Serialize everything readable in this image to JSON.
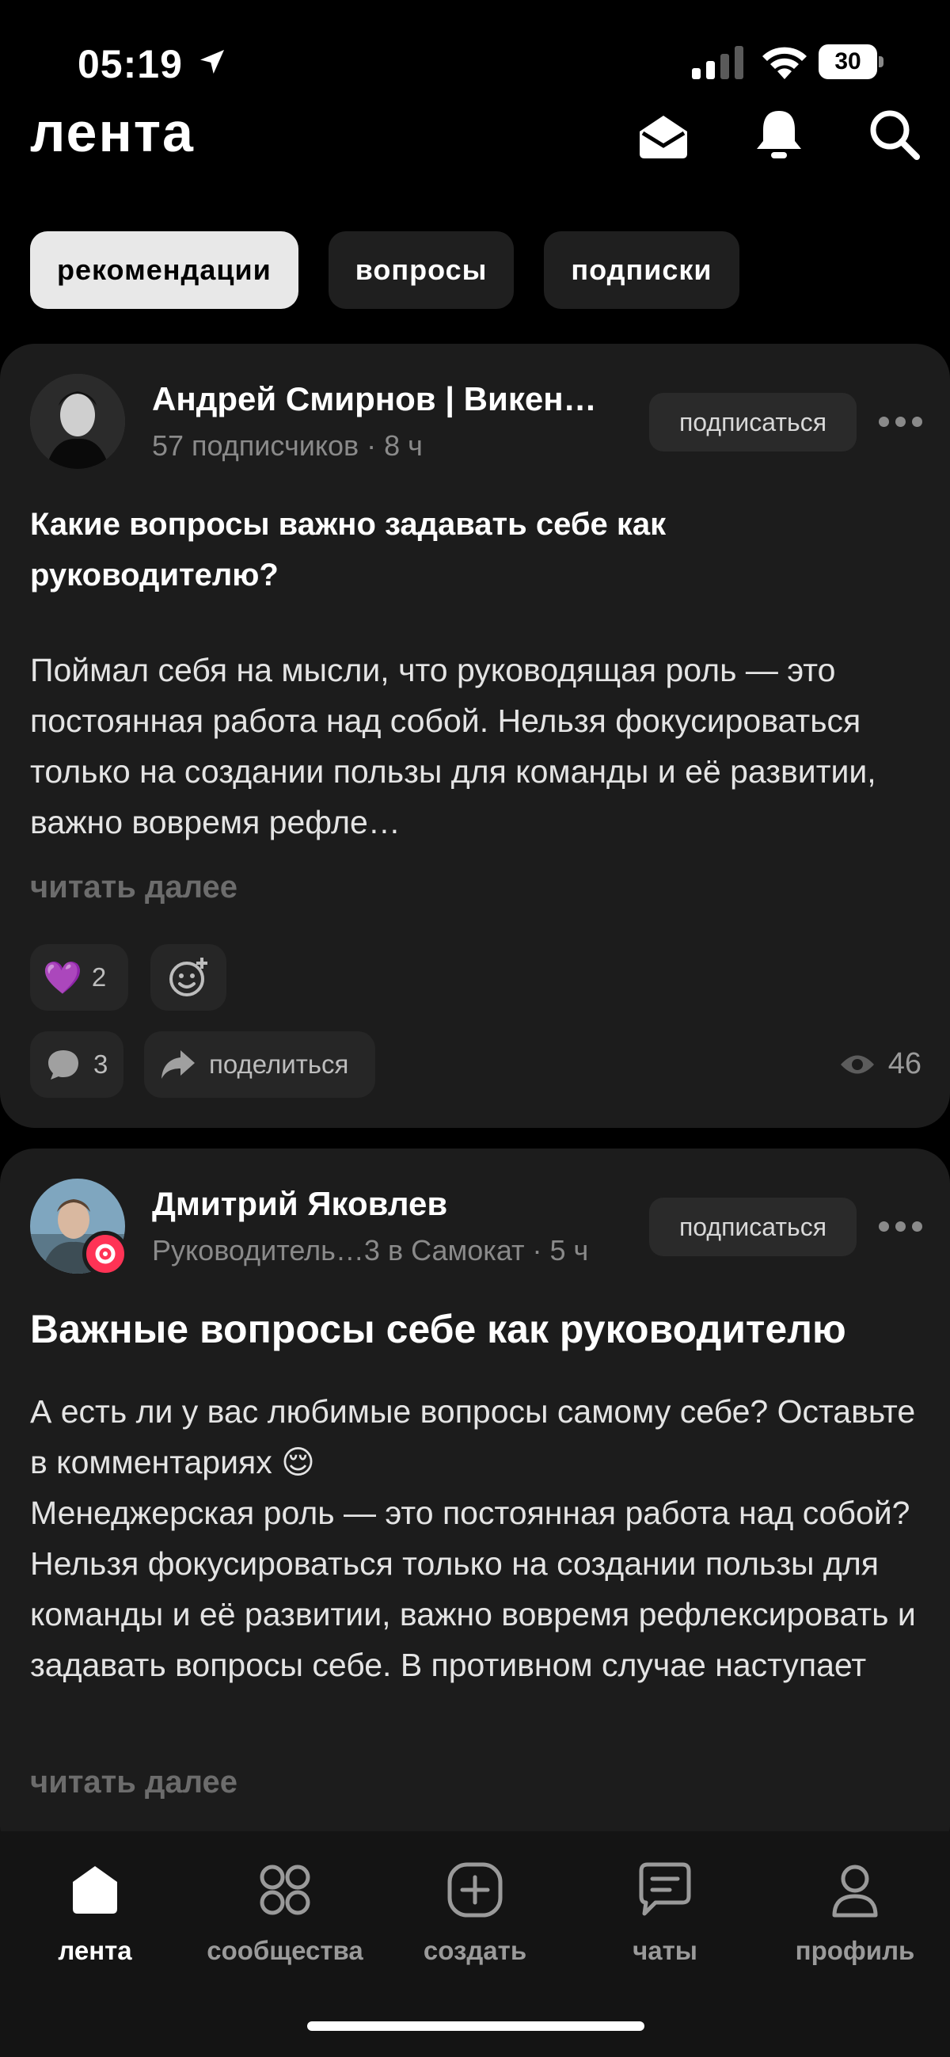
{
  "status_bar": {
    "time": "05:19",
    "battery": "30"
  },
  "header": {
    "title": "лента"
  },
  "tabs": [
    {
      "label": "рекомендации",
      "active": true
    },
    {
      "label": "вопросы",
      "active": false
    },
    {
      "label": "подписки",
      "active": false
    }
  ],
  "posts": [
    {
      "author": "Андрей Смирнов | Викен…",
      "meta": "57 подписчиков · 8 ч",
      "subscribe_label": "подписаться",
      "title": "Какие вопросы важно задавать себе как руководителю?",
      "body": "Поймал себя на мысли, что руководящая роль — это постоянная работа над собой. Нельзя фокусироваться только на создании пользы для команды и её развитии, важно вовремя рефле…",
      "read_more": "читать далее",
      "reaction_emoji": "💜",
      "reaction_count": "2",
      "comments_count": "3",
      "share_label": "поделиться",
      "views": "46"
    },
    {
      "author": "Дмитрий Яковлев",
      "meta": "Руководитель…3 в Самокат · 5 ч",
      "subscribe_label": "подписаться",
      "title": "Важные вопросы себе как руководителю",
      "body": "А есть ли у вас любимые вопросы самому себе? Оставьте в комментариях 😌\nМенеджерская роль — это постоянная работа над собой? Нельзя фокусироваться только на создании пользы для команды и её развитии, важно вовремя рефлексировать и задавать вопросы себе. В противном случае наступает стагнация, когда вы в…",
      "read_more": "читать далее"
    }
  ],
  "bottom_nav": [
    {
      "label": "лента",
      "icon": "home-icon",
      "active": true
    },
    {
      "label": "сообщества",
      "icon": "grid-icon",
      "active": false
    },
    {
      "label": "создать",
      "icon": "plus-square-icon",
      "active": false
    },
    {
      "label": "чаты",
      "icon": "chat-icon",
      "active": false
    },
    {
      "label": "профиль",
      "icon": "person-icon",
      "active": false
    }
  ],
  "colors": {
    "background": "#000000",
    "card": "#1c1c1c",
    "accent_badge": "#ff3355",
    "active_tab": "#e8e8e8"
  }
}
